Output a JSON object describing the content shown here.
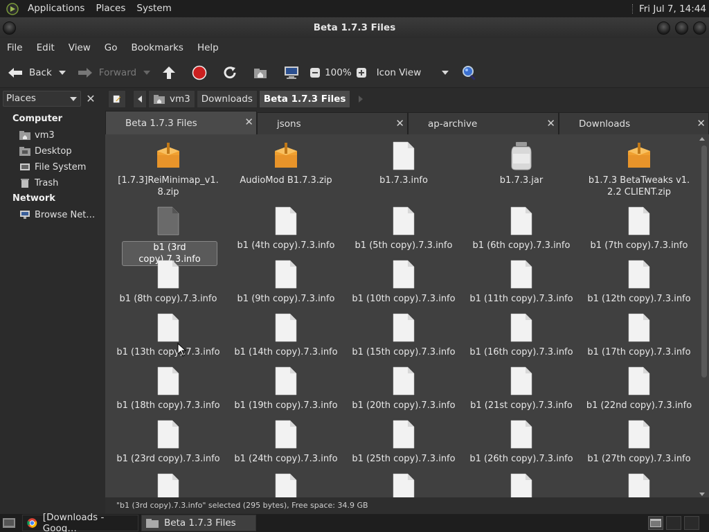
{
  "top_panel": {
    "menus": [
      "Applications",
      "Places",
      "System"
    ],
    "clock": "Fri Jul 7, 14:44"
  },
  "window": {
    "title": "Beta 1.7.3 Files"
  },
  "menubar": [
    "File",
    "Edit",
    "View",
    "Go",
    "Bookmarks",
    "Help"
  ],
  "toolbar": {
    "back_label": "Back",
    "forward_label": "Forward",
    "zoom": "100%",
    "view_mode": "Icon View"
  },
  "sidebar": {
    "selector": "Places",
    "sections": [
      {
        "heading": "Computer",
        "items": [
          "vm3",
          "Desktop",
          "File System",
          "Trash"
        ]
      },
      {
        "heading": "Network",
        "items": [
          "Browse Net…"
        ]
      }
    ]
  },
  "pathbar": [
    "vm3",
    "Downloads",
    "Beta 1.7.3 Files"
  ],
  "tabs": [
    "Beta 1.7.3 Files",
    "jsons",
    "ap-archive",
    "Downloads"
  ],
  "files": [
    {
      "name": "[1.7.3]ReiMinimap_v1.8.zip",
      "line1": "[1.7.3]ReiMinimap_v1.",
      "line2": "8.zip",
      "icon": "zip-archive-icon"
    },
    {
      "name": "AudioMod B1.7.3.zip",
      "line1": "AudioMod B1.7.3.zip",
      "line2": "",
      "icon": "zip-archive-icon"
    },
    {
      "name": "b1.7.3.info",
      "line1": "b1.7.3.info",
      "line2": "",
      "icon": "document-icon"
    },
    {
      "name": "b1.7.3.jar",
      "line1": "b1.7.3.jar",
      "line2": "",
      "icon": "jar-icon"
    },
    {
      "name": "b1.7.3 BetaTweaks v1.2.2 CLIENT.zip",
      "line1": "b1.7.3 BetaTweaks v1.",
      "line2": "2.2 CLIENT.zip",
      "icon": "zip-archive-icon"
    },
    {
      "name": "b1 (3rd copy).7.3.info",
      "line1": "b1 (3rd copy).7.3.info",
      "line2": "",
      "icon": "document-icon",
      "selected": true
    },
    {
      "name": "b1 (4th copy).7.3.info",
      "line1": "b1 (4th copy).7.3.info",
      "line2": "",
      "icon": "document-icon"
    },
    {
      "name": "b1 (5th copy).7.3.info",
      "line1": "b1 (5th copy).7.3.info",
      "line2": "",
      "icon": "document-icon"
    },
    {
      "name": "b1 (6th copy).7.3.info",
      "line1": "b1 (6th copy).7.3.info",
      "line2": "",
      "icon": "document-icon"
    },
    {
      "name": "b1 (7th copy).7.3.info",
      "line1": "b1 (7th copy).7.3.info",
      "line2": "",
      "icon": "document-icon"
    },
    {
      "name": "b1 (8th copy).7.3.info",
      "line1": "b1 (8th copy).7.3.info",
      "line2": "",
      "icon": "document-icon"
    },
    {
      "name": "b1 (9th copy).7.3.info",
      "line1": "b1 (9th copy).7.3.info",
      "line2": "",
      "icon": "document-icon"
    },
    {
      "name": "b1 (10th copy).7.3.info",
      "line1": "b1 (10th copy).7.3.info",
      "line2": "",
      "icon": "document-icon"
    },
    {
      "name": "b1 (11th copy).7.3.info",
      "line1": "b1 (11th copy).7.3.info",
      "line2": "",
      "icon": "document-icon"
    },
    {
      "name": "b1 (12th copy).7.3.info",
      "line1": "b1 (12th copy).7.3.info",
      "line2": "",
      "icon": "document-icon"
    },
    {
      "name": "b1 (13th copy).7.3.info",
      "line1": "b1 (13th copy).7.3.info",
      "line2": "",
      "icon": "document-icon"
    },
    {
      "name": "b1 (14th copy).7.3.info",
      "line1": "b1 (14th copy).7.3.info",
      "line2": "",
      "icon": "document-icon"
    },
    {
      "name": "b1 (15th copy).7.3.info",
      "line1": "b1 (15th copy).7.3.info",
      "line2": "",
      "icon": "document-icon"
    },
    {
      "name": "b1 (16th copy).7.3.info",
      "line1": "b1 (16th copy).7.3.info",
      "line2": "",
      "icon": "document-icon"
    },
    {
      "name": "b1 (17th copy).7.3.info",
      "line1": "b1 (17th copy).7.3.info",
      "line2": "",
      "icon": "document-icon"
    },
    {
      "name": "b1 (18th copy).7.3.info",
      "line1": "b1 (18th copy).7.3.info",
      "line2": "",
      "icon": "document-icon"
    },
    {
      "name": "b1 (19th copy).7.3.info",
      "line1": "b1 (19th copy).7.3.info",
      "line2": "",
      "icon": "document-icon"
    },
    {
      "name": "b1 (20th copy).7.3.info",
      "line1": "b1 (20th copy).7.3.info",
      "line2": "",
      "icon": "document-icon"
    },
    {
      "name": "b1 (21st copy).7.3.info",
      "line1": "b1 (21st copy).7.3.info",
      "line2": "",
      "icon": "document-icon"
    },
    {
      "name": "b1 (22nd copy).7.3.info",
      "line1": "b1 (22nd copy).7.3.info",
      "line2": "",
      "icon": "document-icon"
    },
    {
      "name": "b1 (23rd copy).7.3.info",
      "line1": "b1 (23rd copy).7.3.info",
      "line2": "",
      "icon": "document-icon"
    },
    {
      "name": "b1 (24th copy).7.3.info",
      "line1": "b1 (24th copy).7.3.info",
      "line2": "",
      "icon": "document-icon"
    },
    {
      "name": "b1 (25th copy).7.3.info",
      "line1": "b1 (25th copy).7.3.info",
      "line2": "",
      "icon": "document-icon"
    },
    {
      "name": "b1 (26th copy).7.3.info",
      "line1": "b1 (26th copy).7.3.info",
      "line2": "",
      "icon": "document-icon"
    },
    {
      "name": "b1 (27th copy).7.3.info",
      "line1": "b1 (27th copy).7.3.info",
      "line2": "",
      "icon": "document-icon"
    },
    {
      "name": "",
      "line1": "",
      "line2": "",
      "icon": "document-icon"
    },
    {
      "name": "",
      "line1": "",
      "line2": "",
      "icon": "document-icon"
    },
    {
      "name": "",
      "line1": "",
      "line2": "",
      "icon": "document-icon"
    },
    {
      "name": "",
      "line1": "",
      "line2": "",
      "icon": "document-icon"
    },
    {
      "name": "",
      "line1": "",
      "line2": "",
      "icon": "document-icon"
    }
  ],
  "statusbar": "\"b1 (3rd copy).7.3.info\" selected (295 bytes), Free space: 34.9 GB",
  "taskbar": [
    {
      "label": "[Downloads - Goog…",
      "icon": "chrome-icon",
      "active": false
    },
    {
      "label": "Beta 1.7.3 Files",
      "icon": "folder-icon",
      "active": true
    }
  ],
  "colors": {
    "panel_bg": "#1e1e1e",
    "window_bg": "#2e2e2e",
    "view_bg": "#404040",
    "folder_orange": "#f0a030",
    "stop_red": "#cc2020",
    "search_blue": "#3a6fd0"
  }
}
